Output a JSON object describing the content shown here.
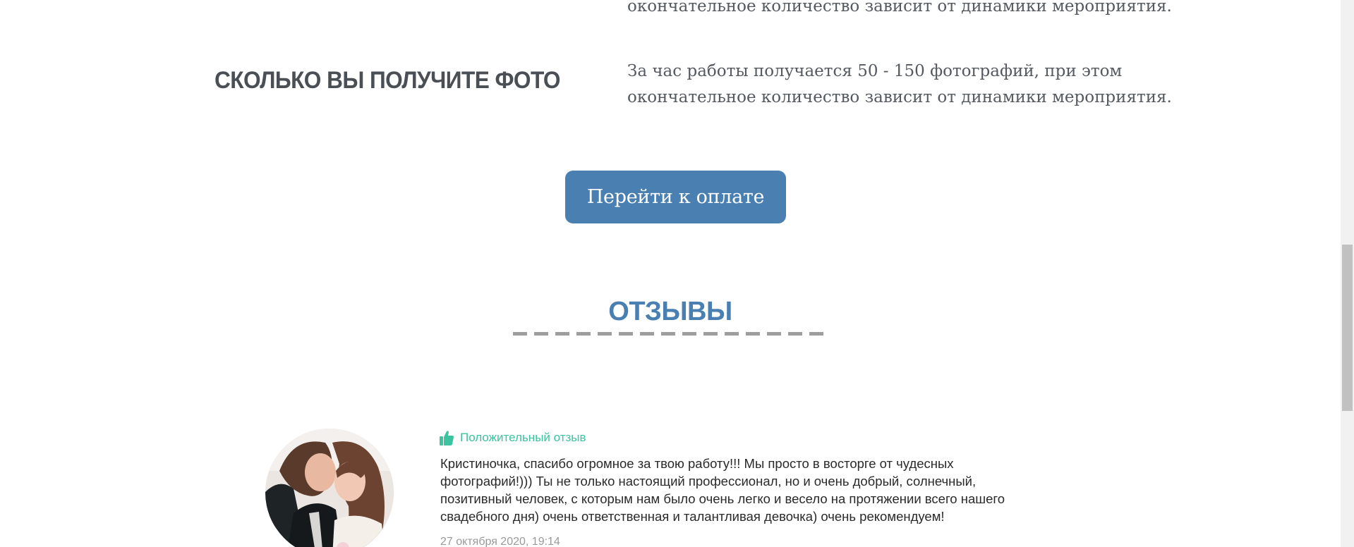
{
  "previous_item": {
    "text_tail": "окончательное количество зависит от динамики мероприятия."
  },
  "info": {
    "heading": "СКОЛЬКО ВЫ ПОЛУЧИТЕ ФОТО",
    "text_lines": [
      "За час работы получается 50 - 150 фотографий, при этом",
      "окончательное количество зависит от динамики мероприятия."
    ]
  },
  "payment": {
    "button_label": "Перейти к оплате",
    "button_color": "#4a7fb2"
  },
  "reviews": {
    "title": "ОТЗЫВЫ",
    "title_color": "#4a7fb2",
    "items": [
      {
        "badge_icon": "thumbs-up-icon",
        "badge_label": "Положительный отзыв",
        "badge_color": "#3cc39f",
        "text_lines": [
          "Кристиночка, спасибо огромное за твою работу!!! Мы просто в восторге от чудесных",
          "фотографий!))) Ты не только настоящий профессионал, но и очень добрый, солнечный,",
          "позитивный человек, с которым нам было очень легко и весело на протяжении всего нашего",
          "свадебного дня) очень ответственная и талантливая девочка) очень рекомендуем!"
        ],
        "date": "27 октября 2020, 19:14"
      }
    ]
  }
}
